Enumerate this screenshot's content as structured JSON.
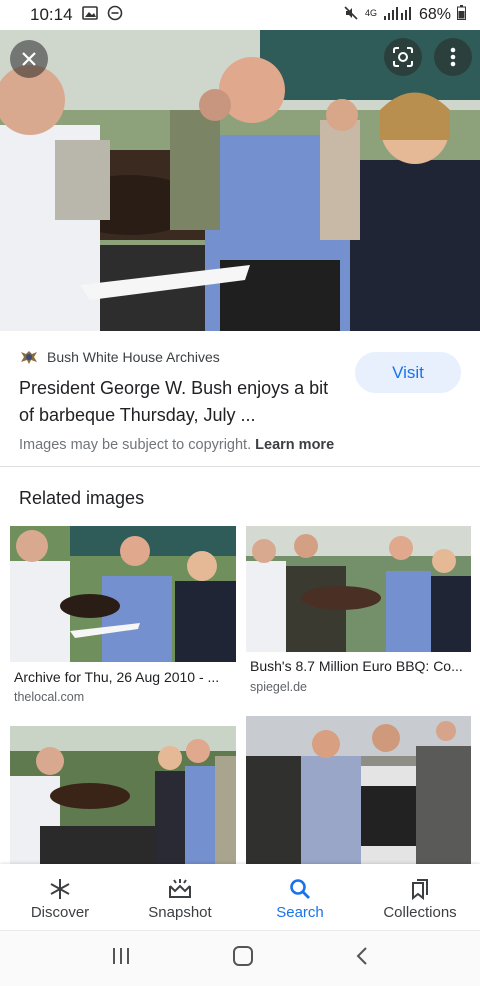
{
  "status_bar": {
    "time": "10:14",
    "network": "4G",
    "battery": "68%"
  },
  "hero": {
    "image_desc": "grill-photo"
  },
  "result": {
    "source": "Bush White House Archives",
    "title": "President George W. Bush enjoys a bit of barbeque Thursday, July ...",
    "visit_label": "Visit",
    "copyright_text": "Images may be subject to copyright.",
    "learn_more": "Learn more"
  },
  "related": {
    "heading": "Related images",
    "items": [
      {
        "caption": "Archive for Thu, 26 Aug 2010 - ...",
        "source": "thelocal.com"
      },
      {
        "caption": "Bush's 8.7 Million Euro BBQ: Co...",
        "source": "spiegel.de"
      },
      {
        "caption": "",
        "source": ""
      },
      {
        "caption": "",
        "source": ""
      }
    ]
  },
  "bottom_nav": {
    "items": [
      {
        "label": "Discover",
        "icon": "asterisk-icon"
      },
      {
        "label": "Snapshot",
        "icon": "snapshot-icon"
      },
      {
        "label": "Search",
        "icon": "search-icon"
      },
      {
        "label": "Collections",
        "icon": "collections-icon"
      }
    ],
    "active": "Search"
  },
  "colors": {
    "accent": "#1a73e8",
    "visit_bg": "#e8f0fe"
  }
}
